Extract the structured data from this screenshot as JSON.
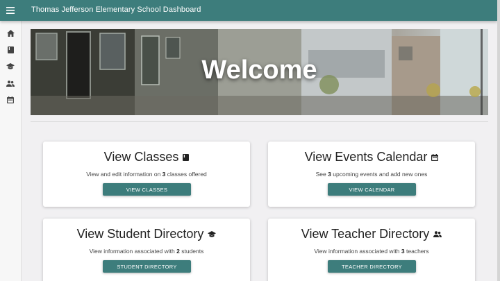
{
  "app": {
    "title": "Thomas Jefferson Elementary School Dashboard"
  },
  "colors": {
    "primary": "#3d7d7c",
    "background": "#f1f0f2"
  },
  "sidebar": {
    "items": [
      {
        "icon": "home-icon"
      },
      {
        "icon": "book-icon"
      },
      {
        "icon": "graduation-cap-icon"
      },
      {
        "icon": "people-icon"
      },
      {
        "icon": "calendar-icon"
      }
    ]
  },
  "hero": {
    "title": "Welcome"
  },
  "cards": {
    "classes": {
      "title": "View Classes",
      "desc_prefix": "View and edit information on ",
      "count": "3",
      "desc_suffix": " classes offered",
      "button": "VIEW CLASSES"
    },
    "events": {
      "title": "View Events Calendar",
      "desc_prefix": "See ",
      "count": "3",
      "desc_suffix": " upcoming events and add new ones",
      "button": "VIEW CALENDAR"
    },
    "students": {
      "title": "View Student Directory",
      "desc_prefix": "View information associated with ",
      "count": "2",
      "desc_suffix": " students",
      "button": "STUDENT DIRECTORY"
    },
    "teachers": {
      "title": "View Teacher Directory",
      "desc_prefix": "View information associated with ",
      "count": "3",
      "desc_suffix": " teachers",
      "button": "TEACHER DIRECTORY"
    }
  }
}
